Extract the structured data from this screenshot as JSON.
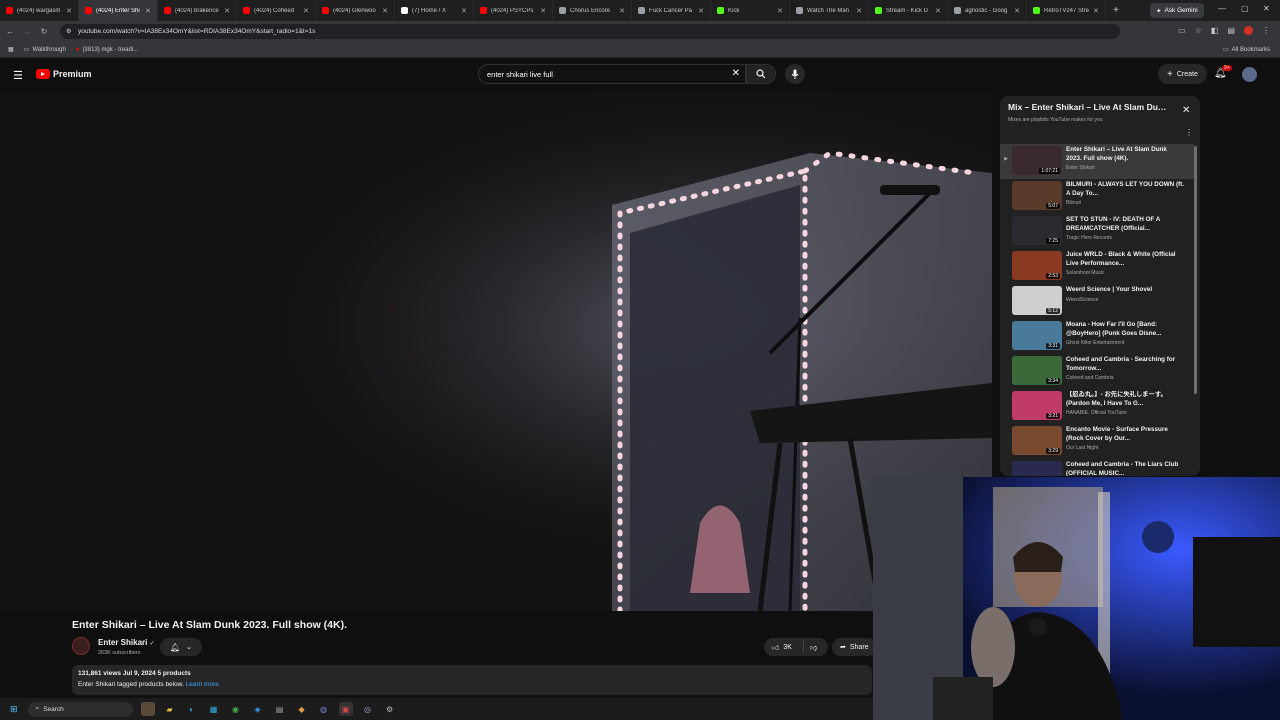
{
  "browser": {
    "tabs": [
      {
        "label": "(4024) wargasm",
        "color": "#ff0000"
      },
      {
        "label": "(4024) Enter Shi",
        "color": "#ff0000",
        "active": true
      },
      {
        "label": "(4024) brakence",
        "color": "#ff0000"
      },
      {
        "label": "(4024) Coheed",
        "color": "#ff0000"
      },
      {
        "label": "(4024) Glenwoo",
        "color": "#ff0000"
      },
      {
        "label": "(7) Home / X",
        "color": "#ffffff"
      },
      {
        "label": "(4024) PSYCPs",
        "color": "#ff0000"
      },
      {
        "label": "Chorus Encore",
        "color": "#9aa0a6"
      },
      {
        "label": "Fuck Cancer Pa",
        "color": "#9aa0a6"
      },
      {
        "label": "Kick",
        "color": "#53fc18"
      },
      {
        "label": "Watch The Man",
        "color": "#9aa0a6"
      },
      {
        "label": "Stream - Kick D",
        "color": "#53fc18"
      },
      {
        "label": "agnostic - Goog",
        "color": "#9aa0a6"
      },
      {
        "label": "RetroTV247 Stre",
        "color": "#53fc18"
      }
    ],
    "gemini_label": "Ask Gemini",
    "url": "youtube.com/watch?v=IA38Ex34OmY&list=RDIA38Ex34OmY&start_radio=1&t=1s",
    "bookmarks": [
      {
        "label": "Walkthrough"
      },
      {
        "label": "(3813) mgk - treadi..."
      }
    ],
    "all_bookmarks": "All Bookmarks"
  },
  "youtube": {
    "logo_text": "Premium",
    "search_query": "enter shikari live full",
    "create_label": "Create",
    "notification_badge": "9+"
  },
  "video": {
    "title": "Enter Shikari – Live At Slam Dunk 2023. Full show (4K).",
    "channel": "Enter Shikari",
    "subscribers": "263K subscribers",
    "likes": "3K",
    "share_label": "Share",
    "meta": "131,861 views  Jul 9, 2024  5 products",
    "desc_text": "Enter Shikari tagged products below.",
    "learn_more": "Learn more"
  },
  "playlist": {
    "title": "Mix – Enter Shikari – Live At Slam Dunk 2023. Full show (4K).",
    "subtitle": "Mixes are playlists YouTube makes for you",
    "items": [
      {
        "title": "Enter Shikari – Live At Slam Dunk 2023. Full show (4K).",
        "channel": "Enter Shikari",
        "duration": "1:07:21",
        "current": true,
        "thumb": "#3a2a2e"
      },
      {
        "title": "BILMURI - ALWAYS LET YOU DOWN (ft. A Day To...",
        "channel": "Bilmuri",
        "duration": "5:07",
        "thumb": "#5a3a2a"
      },
      {
        "title": "SET TO STUN - IV: DEATH OF A DREAMCATCHER (Official...",
        "channel": "Tragic Hero Records",
        "duration": "7:25",
        "thumb": "#2a2a30"
      },
      {
        "title": "Juice WRLD - Black & White (Official Live Performance...",
        "channel": "Solarshoot Music",
        "duration": "2:53",
        "thumb": "#8a3a20"
      },
      {
        "title": "Weerd Science | Your Shovel",
        "channel": "WeerdScience",
        "duration": "5:12",
        "thumb": "#cfcfcf"
      },
      {
        "title": "Moana - How Far I'll Go [Band: @BoyHero] (Punk Goes Disne...",
        "channel": "Ghost Killer Entertainment",
        "duration": "3:31",
        "thumb": "#4a7a9a"
      },
      {
        "title": "Coheed and Cambria - Searching for Tomorrow...",
        "channel": "Coheed and Cambria",
        "duration": "3:34",
        "thumb": "#3a6a3a"
      },
      {
        "title": "【忍ゐ丸。】- お先に失礼しまーす。 (Pardon Me, I Have To G...",
        "channel": "HANABIE. Official YouTube",
        "duration": "3:21",
        "thumb": "#c03a6a"
      },
      {
        "title": "Encanto Movie - Surface Pressure (Rock Cover by Our...",
        "channel": "Our Last Night",
        "duration": "3:29",
        "thumb": "#7a4a30"
      },
      {
        "title": "Coheed and Cambria - The Liars Club (OFFICIAL MUSIC...",
        "channel": "Coheed and Cambria",
        "duration": "",
        "thumb": "#2a2a50"
      }
    ]
  },
  "taskbar": {
    "search_label": "Search"
  }
}
